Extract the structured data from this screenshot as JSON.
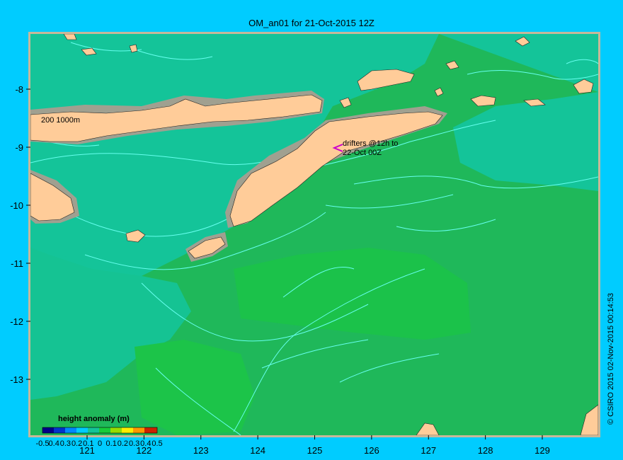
{
  "title": "OM_an01 for 21-Oct-2015 12Z",
  "depth_label": "200  1000m",
  "drifters_label_line1": "drifters @12h to",
  "drifters_label_line2": "22-Oct 00Z",
  "legend_title": "height anomaly  (m)",
  "colorbar_ticks": [
    "-0.5",
    "0.4",
    "0.3",
    "0.2",
    "0.1",
    "0",
    "0.1",
    "0.2",
    "0.3",
    "0.4",
    "0.5"
  ],
  "credit": "© CSIRO  2015   02-Nov-2015 00:14:53",
  "x_axis": {
    "ticks": [
      {
        "value": 121,
        "label": "121"
      },
      {
        "value": 122,
        "label": "122"
      },
      {
        "value": 123,
        "label": "123"
      },
      {
        "value": 124,
        "label": "124"
      },
      {
        "value": 125,
        "label": "125"
      },
      {
        "value": 126,
        "label": "126"
      },
      {
        "value": 127,
        "label": "127"
      },
      {
        "value": 128,
        "label": "128"
      },
      {
        "value": 129,
        "label": "129"
      }
    ]
  },
  "y_axis": {
    "ticks": [
      {
        "value": -8,
        "label": "-8"
      },
      {
        "value": -9,
        "label": "-9"
      },
      {
        "value": -10,
        "label": "-10"
      },
      {
        "value": -11,
        "label": "-11"
      },
      {
        "value": -12,
        "label": "-12"
      },
      {
        "value": -13,
        "label": "-13"
      }
    ]
  },
  "map_extent": {
    "lon_min": 120.0,
    "lon_max": 130.0,
    "lat_min": -14.0,
    "lat_max": -7.0
  },
  "colors": {
    "background": "#00ccff",
    "ocean_main": "#1fb85a",
    "ocean_teal": "#14c499",
    "ocean_bright": "#18cc3a",
    "land": "#ffcc99",
    "shelf": "#a0a090",
    "contour": "#66ffee",
    "drifter": "#cc00cc",
    "frame": "#c8b89a"
  }
}
